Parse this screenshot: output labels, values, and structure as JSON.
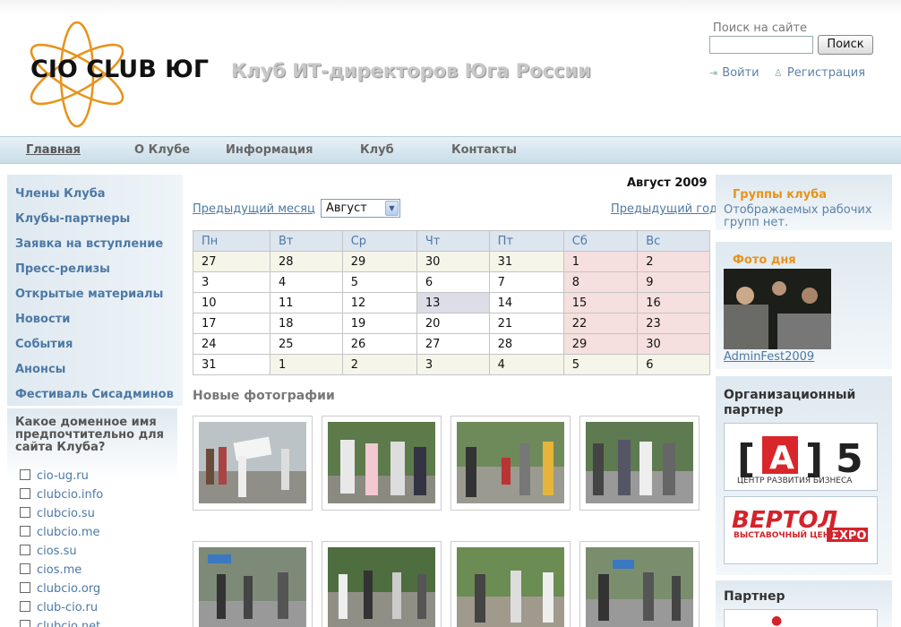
{
  "header": {
    "logo_text": "CIO CLUB ЮГ",
    "tagline": "Клуб ИТ-директоров Юга России",
    "search_label": "Поиск на сайте",
    "search_value": "",
    "search_button": "Поиск",
    "login": "Войти",
    "register": "Регистрация"
  },
  "nav": [
    "Главная",
    "О Клубе",
    "Информация",
    "Клуб",
    "Контакты"
  ],
  "sidebar": {
    "menu": [
      "Члены Клуба",
      "Клубы-партнеры",
      "Заявка на вступление",
      "Пресс-релизы",
      "Открытые материалы",
      "Новости",
      "События",
      "Анонсы",
      "Фестиваль Сисадминов"
    ],
    "poll_question": "Какое доменное имя предпочтительно для сайта Клуба?",
    "poll_options": [
      "cio-ug.ru",
      "clubcio.info",
      "clubcio.su",
      "clubcio.me",
      "cios.su",
      "cios.me",
      "clubcio.org",
      "club-cio.ru",
      "clubcio.net"
    ]
  },
  "calendar": {
    "title": "Август 2009",
    "prev_month": "Предыдущий месяц",
    "month_select": "Август",
    "prev_year": "Предыдущий год",
    "weekdays": [
      "Пн",
      "Вт",
      "Ср",
      "Чт",
      "Пт",
      "Сб",
      "Вс"
    ],
    "weeks": [
      [
        "27",
        "28",
        "29",
        "30",
        "31",
        "1",
        "2"
      ],
      [
        "3",
        "4",
        "5",
        "6",
        "7",
        "8",
        "9"
      ],
      [
        "10",
        "11",
        "12",
        "13",
        "14",
        "15",
        "16"
      ],
      [
        "17",
        "18",
        "19",
        "20",
        "21",
        "22",
        "23"
      ],
      [
        "24",
        "25",
        "26",
        "27",
        "28",
        "29",
        "30"
      ],
      [
        "31",
        "1",
        "2",
        "3",
        "4",
        "5",
        "6"
      ]
    ]
  },
  "photos": {
    "title": "Новые фотографии"
  },
  "right": {
    "groups_title": "Группы клуба",
    "groups_text": "Отображаемых рабочих групп нет.",
    "photo_title": "Фото дня",
    "photo_caption": "AdminFest2009",
    "org_partner_title": "Организационный партнер",
    "partner1_label": "ЦЕНТР РАЗВИТИЯ БИЗНЕСА",
    "partner2_label": "ВЫСТАВОЧНЫЙ ЦЕНТР",
    "partner_title": "Партнер"
  },
  "colors": {
    "link": "#4d79a6",
    "accent_orange": "#e8931a",
    "nav_bg": "#c9dde8"
  }
}
